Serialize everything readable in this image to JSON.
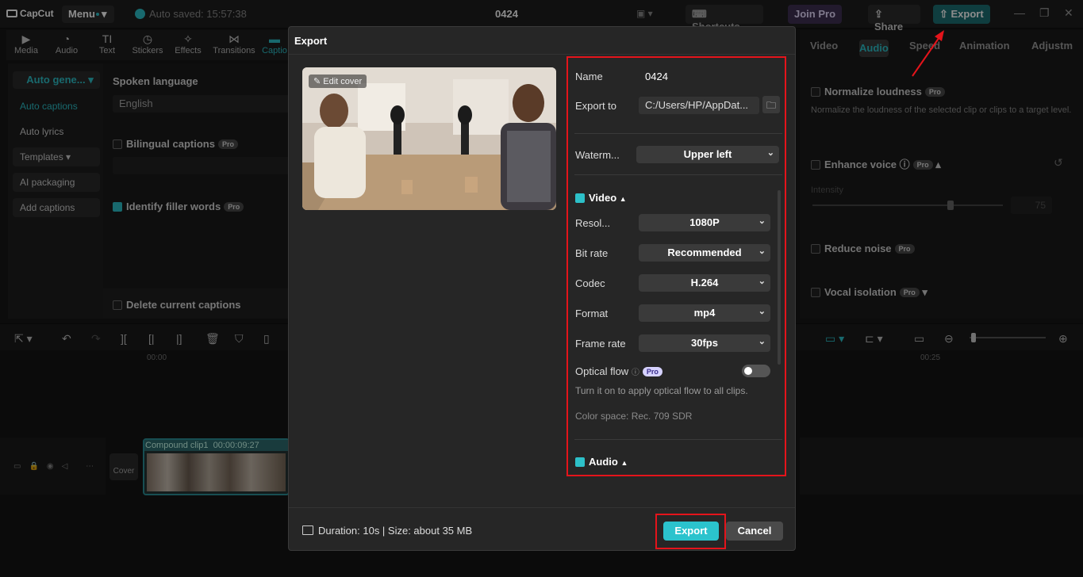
{
  "app": {
    "logo": "CapCut",
    "menu_label": "Menu",
    "autosave": "Auto saved: 15:57:38",
    "project_title": "0424",
    "shortcuts_label": "Shortcuts",
    "joinpro_label": "Join Pro",
    "share_label": "Share",
    "export_label": "Export"
  },
  "tools": [
    "Media",
    "Audio",
    "Text",
    "Stickers",
    "Effects",
    "Transitions",
    "Captio"
  ],
  "leftnav": {
    "items": [
      "Auto gene...",
      "Auto captions",
      "Auto lyrics",
      "Templates",
      "AI packaging",
      "Add captions"
    ]
  },
  "captions": {
    "spoken_language_label": "Spoken language",
    "spoken_language_value": "English",
    "bilingual_label": "Bilingual captions",
    "filler_label": "Identify filler words",
    "delete_label": "Delete current captions",
    "pro_badge": "Pro"
  },
  "rightpanel": {
    "tabs": [
      "Video",
      "Audio",
      "Speed",
      "Animation",
      "Adjustm"
    ],
    "normalize_label": "Normalize loudness",
    "normalize_desc": "Normalize the loudness of the selected clip or clips to a target level.",
    "enhance_label": "Enhance voice",
    "intensity_label": "Intensity",
    "intensity_value": "75",
    "reduce_label": "Reduce noise",
    "vocal_label": "Vocal isolation"
  },
  "timeline": {
    "ts_start": "00:00",
    "ts_end": "00:25",
    "clip_label": "Compound clip1",
    "clip_duration": "00:00:09:27",
    "cover_label": "Cover"
  },
  "dialog": {
    "title": "Export",
    "edit_cover": "Edit cover",
    "name_label": "Name",
    "name_value": "0424",
    "exportto_label": "Export to",
    "exportto_value": "C:/Users/HP/AppDat...",
    "watermark_label": "Waterm...",
    "watermark_value": "Upper left",
    "video_section": "Video",
    "resolution_label": "Resol...",
    "resolution_value": "1080P",
    "bitrate_label": "Bit rate",
    "bitrate_value": "Recommended",
    "codec_label": "Codec",
    "codec_value": "H.264",
    "format_label": "Format",
    "format_value": "mp4",
    "framerate_label": "Frame rate",
    "framerate_value": "30fps",
    "optical_label": "Optical flow",
    "optical_desc": "Turn it on to apply optical flow to all clips.",
    "colorspace": "Color space: Rec. 709 SDR",
    "audio_section": "Audio",
    "duration_text": "Duration: 10s | Size: about 35 MB",
    "export_button": "Export",
    "cancel_button": "Cancel"
  },
  "colors": {
    "accent": "#2dc0c8",
    "highlight": "#e4141b"
  }
}
